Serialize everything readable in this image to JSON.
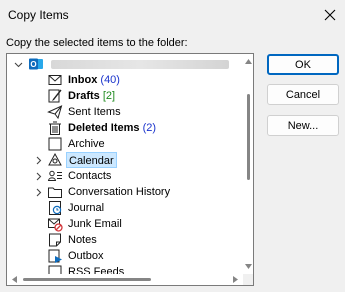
{
  "window": {
    "title": "Copy Items",
    "close_icon": "close-icon"
  },
  "prompt": "Copy the selected items to the folder:",
  "tree": {
    "account": {
      "icon": "outlook-icon",
      "label": ""
    },
    "folders": [
      {
        "label": "Inbox",
        "count": "(40)",
        "count_color": "#1a33cc",
        "bold": true,
        "icon": "inbox-icon",
        "expandable": false
      },
      {
        "label": "Drafts",
        "count": "[2]",
        "count_color": "#1e8a1e",
        "bold": true,
        "icon": "drafts-icon",
        "expandable": false
      },
      {
        "label": "Sent Items",
        "count": "",
        "bold": false,
        "icon": "sent-items-icon",
        "expandable": false
      },
      {
        "label": "Deleted Items",
        "count": "(2)",
        "count_color": "#1a33cc",
        "bold": true,
        "icon": "trash-icon",
        "expandable": false
      },
      {
        "label": "Archive",
        "count": "",
        "bold": false,
        "icon": "archive-icon",
        "expandable": false
      },
      {
        "label": "Calendar",
        "count": "",
        "bold": false,
        "icon": "calendar-icon",
        "expandable": true,
        "selected": true
      },
      {
        "label": "Contacts",
        "count": "",
        "bold": false,
        "icon": "contacts-icon",
        "expandable": true
      },
      {
        "label": "Conversation History",
        "count": "",
        "bold": false,
        "icon": "folder-icon",
        "expandable": true
      },
      {
        "label": "Journal",
        "count": "",
        "bold": false,
        "icon": "journal-icon",
        "expandable": false
      },
      {
        "label": "Junk Email",
        "count": "",
        "bold": false,
        "icon": "junk-email-icon",
        "expandable": false
      },
      {
        "label": "Notes",
        "count": "",
        "bold": false,
        "icon": "notes-icon",
        "expandable": false
      },
      {
        "label": "Outbox",
        "count": "",
        "bold": false,
        "icon": "outbox-icon",
        "expandable": false
      },
      {
        "label": "RSS Feeds",
        "count": "",
        "bold": false,
        "icon": "rss-icon",
        "expandable": false
      }
    ]
  },
  "buttons": {
    "ok": "OK",
    "cancel": "Cancel",
    "new": "New..."
  },
  "colors": {
    "accent": "#0067c0",
    "selection_bg": "#cce8ff",
    "outlook_blue": "#0f6cbd"
  }
}
